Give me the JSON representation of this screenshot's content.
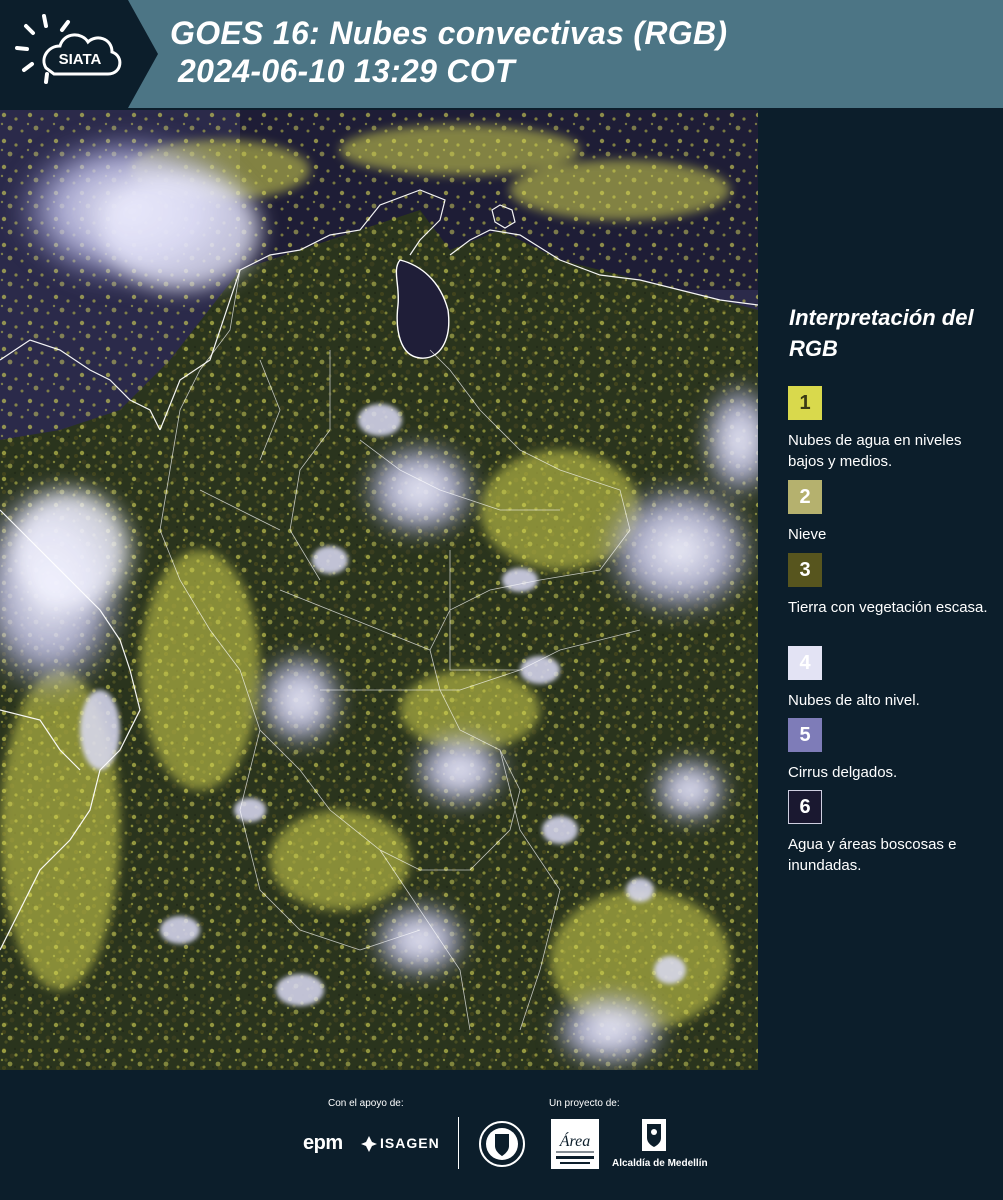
{
  "header": {
    "logo_text": "SIATA",
    "title_line1": "GOES 16: Nubes convectivas (RGB)",
    "title_line2": "2024-06-10 13:29 COT"
  },
  "map": {
    "icon": "satellite-rgb-map-colombia"
  },
  "legend": {
    "title": "Interpretación del RGB",
    "items": [
      {
        "number": "1",
        "label": "Nubes de agua en niveles bajos y medios.",
        "color": "#d9d94c"
      },
      {
        "number": "2",
        "label": "Nieve",
        "color": "#b5b16e"
      },
      {
        "number": "3",
        "label": "Tierra con vegetación escasa.",
        "color": "#57551e"
      },
      {
        "number": "4",
        "label": "Nubes de alto nivel.",
        "color": "#e3e3f4"
      },
      {
        "number": "5",
        "label": "Cirrus delgados.",
        "color": "#7e7cb8"
      },
      {
        "number": "6",
        "label": "Agua y áreas boscosas e inundadas.",
        "color": "#1a1830"
      }
    ]
  },
  "footer": {
    "support_label": "Con el apoyo de:",
    "project_label": "Un proyecto de:",
    "epm": "epm",
    "isagen": "ISAGEN",
    "area_logo_text": "Área",
    "alcaldia": "Alcaldía de Medellín"
  },
  "colors": {
    "header_bg": "#4c7585",
    "panel_bg": "#0c1e2b",
    "cloud_white": "#e8e8f8",
    "cloud_yellow": "#d7d755"
  }
}
